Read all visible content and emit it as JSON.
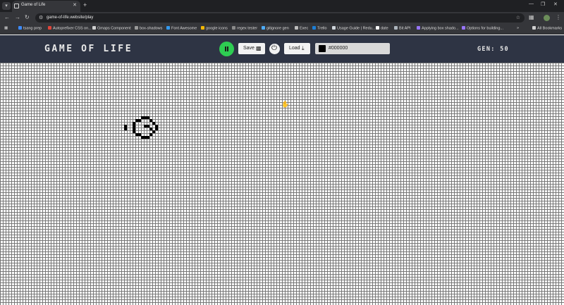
{
  "browser": {
    "tab_title": "Game of Life",
    "url": "game-of-life.website/play",
    "bookmarks": [
      "tsang prep",
      "Autoprefixer CSS on...",
      "Gmaps Component",
      "box-shadows",
      "Font Awesome",
      "google icons",
      "regex tester",
      "gitignore gen",
      "Exec",
      "Trello",
      "Usage Guide | Redu...",
      "date",
      "Bit API",
      "Applying box shado...",
      "Options for building..."
    ],
    "all_bookmarks": "All Bookmarks"
  },
  "app": {
    "title": "GAME OF LIFE",
    "save_label": "Save",
    "load_label": "Load",
    "color_value": "#000000",
    "generation": "GEN: 50",
    "colors": {
      "header_bg": "#2e3444",
      "play_button": "#2ecc52",
      "cell": "#000000"
    }
  },
  "grid": {
    "cell_size_units": 4,
    "live_cells": [
      [
        50,
        19
      ],
      [
        51,
        19
      ],
      [
        52,
        19
      ],
      [
        48,
        20
      ],
      [
        49,
        20
      ],
      [
        53,
        20
      ],
      [
        47,
        21
      ],
      [
        54,
        21
      ],
      [
        44,
        22
      ],
      [
        47,
        22
      ],
      [
        51,
        22
      ],
      [
        52,
        22
      ],
      [
        55,
        22
      ],
      [
        44,
        23
      ],
      [
        47,
        23
      ],
      [
        53,
        23
      ],
      [
        55,
        23
      ],
      [
        47,
        24
      ],
      [
        54,
        24
      ],
      [
        48,
        25
      ],
      [
        49,
        25
      ],
      [
        53,
        25
      ],
      [
        50,
        26
      ],
      [
        51,
        26
      ],
      [
        52,
        26
      ]
    ]
  }
}
